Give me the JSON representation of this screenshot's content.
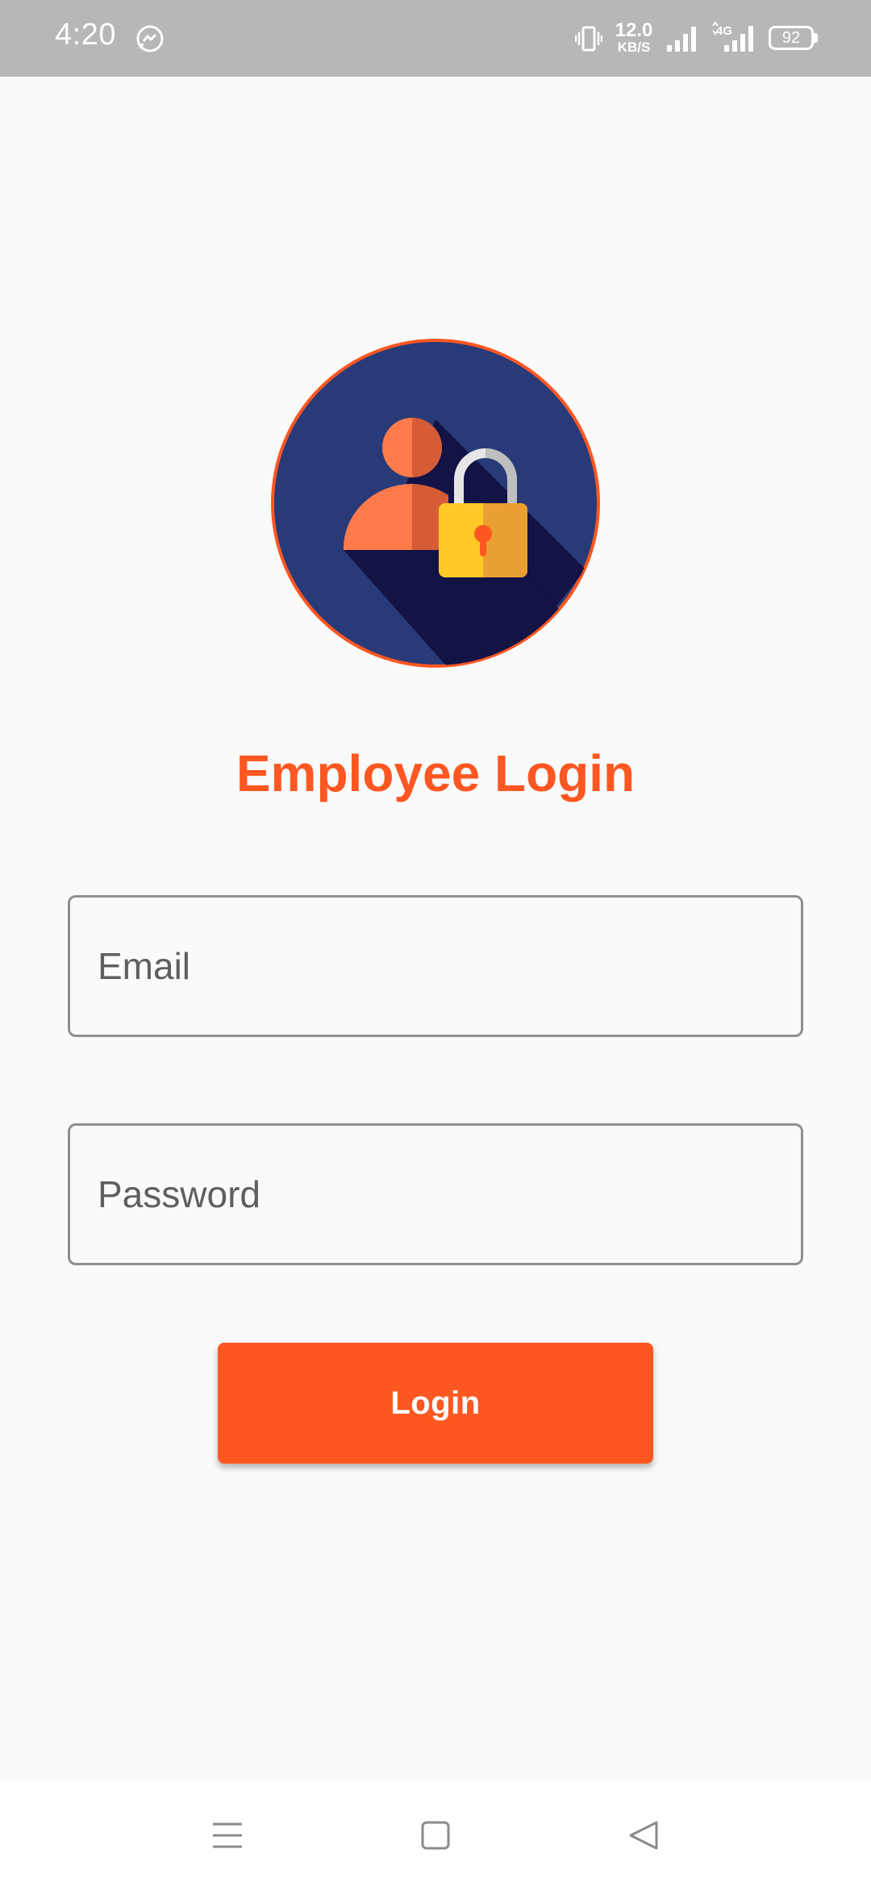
{
  "status_bar": {
    "time": "4:20",
    "net_speed_value": "12.0",
    "net_speed_unit": "KB/S",
    "network_type": "4G",
    "battery": "92",
    "icons": [
      "messenger-icon",
      "vibrate-icon",
      "signal-icon",
      "signal-4g-icon",
      "battery-icon"
    ]
  },
  "app": {
    "logo_icon": "user-lock-icon",
    "title": "Employee Login",
    "email_placeholder": "Email",
    "password_placeholder": "Password",
    "login_label": "Login"
  },
  "nav_bar": {
    "icons": [
      "menu-icon",
      "home-icon",
      "back-icon"
    ]
  },
  "colors": {
    "accent": "#ff5722",
    "logo_background": "#283a78",
    "status_bar": "#b7b7b7",
    "page_background": "#fafafa"
  }
}
